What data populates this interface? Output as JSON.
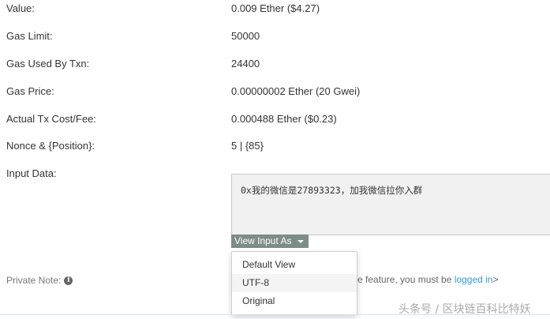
{
  "rows": [
    {
      "label": "Value:",
      "value": "0.009 Ether ($4.27)"
    },
    {
      "label": "Gas Limit:",
      "value": "50000"
    },
    {
      "label": "Gas Used By Txn:",
      "value": "24400"
    },
    {
      "label": "Gas Price:",
      "value": "0.00000002 Ether (20 Gwei)"
    },
    {
      "label": "Actual Tx Cost/Fee:",
      "value": "0.000488 Ether ($0.23)"
    },
    {
      "label": "Nonce & {Position}:",
      "value": "5 | {85}"
    }
  ],
  "input_data": {
    "label": "Input Data:",
    "text": "0x我的微信是27893323，加我微信拉你入群",
    "view_button_label": "View Input As"
  },
  "dropdown": {
    "items": [
      "Default View",
      "UTF-8",
      "Original"
    ],
    "hovered_index": 1
  },
  "private_note": {
    "label": "Private Note:",
    "icon": "info-icon",
    "text_prefix": "e feature, you must be ",
    "link_text": "logged in",
    "text_suffix": ">"
  },
  "watermark": "头条号 / 区块链百科比特妖",
  "colors": {
    "button_bg": "#7c8c86",
    "link": "#3498db",
    "input_bg": "#f1f1f1"
  }
}
